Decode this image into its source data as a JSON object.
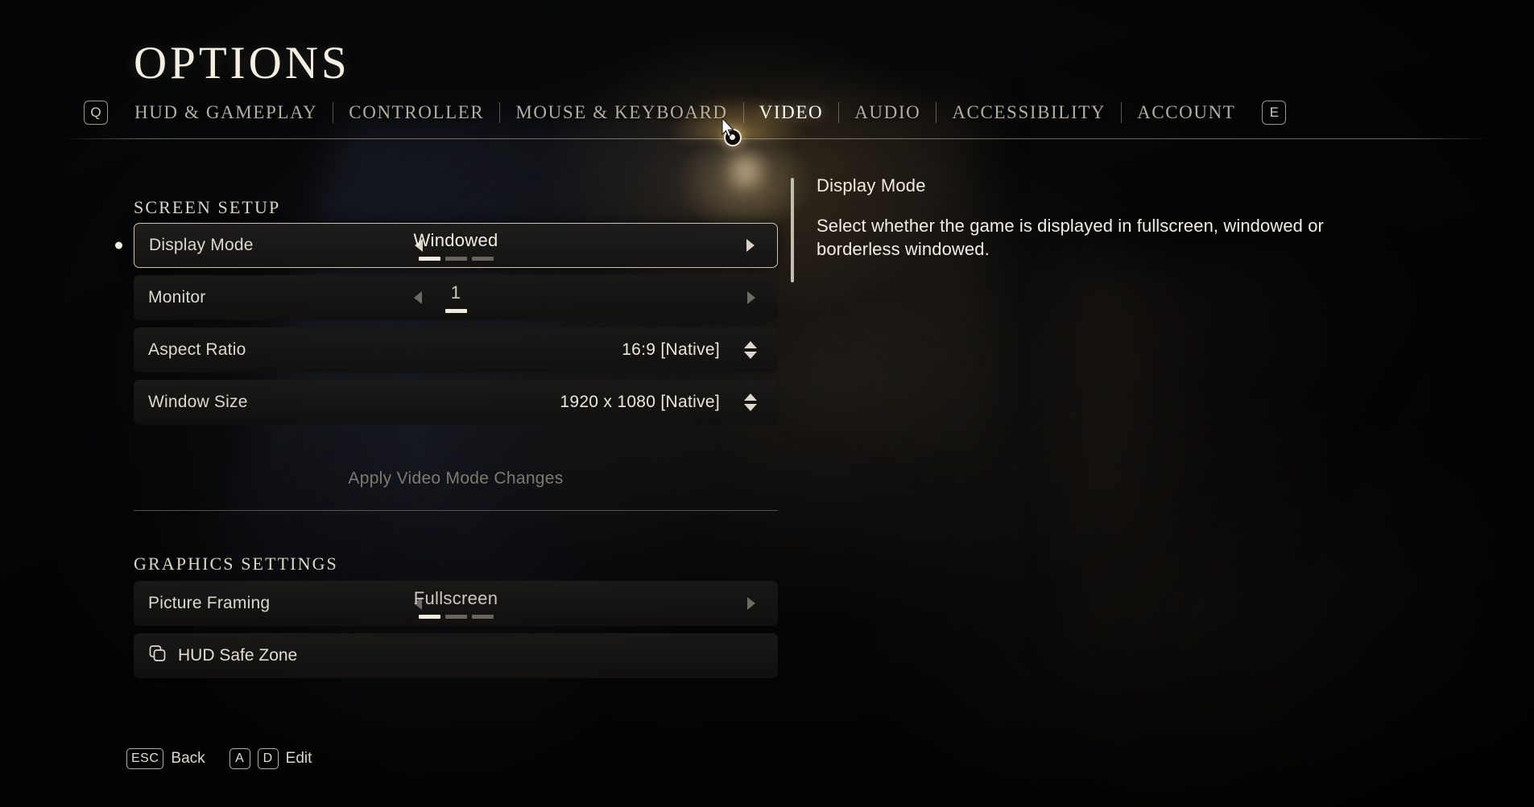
{
  "header": {
    "title": "OPTIONS",
    "prev_tab_key": "Q",
    "next_tab_key": "E",
    "tabs": [
      {
        "label": "HUD & GAMEPLAY",
        "active": false
      },
      {
        "label": "CONTROLLER",
        "active": false
      },
      {
        "label": "MOUSE & KEYBOARD",
        "active": false
      },
      {
        "label": "VIDEO",
        "active": true
      },
      {
        "label": "AUDIO",
        "active": false
      },
      {
        "label": "ACCESSIBILITY",
        "active": false
      },
      {
        "label": "ACCOUNT",
        "active": false
      }
    ]
  },
  "screen_setup": {
    "heading": "SCREEN SETUP",
    "rows": [
      {
        "label": "Display Mode",
        "value": "Windowed",
        "control": "carousel",
        "selected": true,
        "steps": 3,
        "step_index": 0
      },
      {
        "label": "Monitor",
        "value": "1",
        "control": "carousel",
        "selected": false,
        "steps": 1,
        "step_index": 0
      },
      {
        "label": "Aspect Ratio",
        "value": "16:9 [Native]",
        "control": "stepper",
        "selected": false
      },
      {
        "label": "Window Size",
        "value": "1920 x 1080 [Native]",
        "control": "stepper",
        "selected": false
      }
    ],
    "apply_button": {
      "label": "Apply Video Mode Changes",
      "enabled": false
    }
  },
  "graphics_settings": {
    "heading": "GRAPHICS SETTINGS",
    "rows": [
      {
        "label": "Picture Framing",
        "value": "Fullscreen",
        "control": "carousel",
        "selected": false,
        "steps": 3,
        "step_index": 0
      },
      {
        "label": "HUD Safe Zone",
        "control": "submenu",
        "icon": "overlapping-squares-icon",
        "selected": false
      }
    ]
  },
  "description": {
    "title": "Display Mode",
    "body": "Select whether the game is displayed in fullscreen, windowed or borderless windowed."
  },
  "footer": {
    "hints": [
      {
        "key": "ESC",
        "label": "Back"
      },
      {
        "key": "A",
        "key2": "D",
        "label": "Edit"
      }
    ]
  },
  "colors": {
    "text_primary": "#f2ece0",
    "text_dim": "#7e7a72",
    "row_bg": "#1a1917",
    "accent_glow": "#e2b258",
    "highlight_border": "#c9c3b5"
  }
}
